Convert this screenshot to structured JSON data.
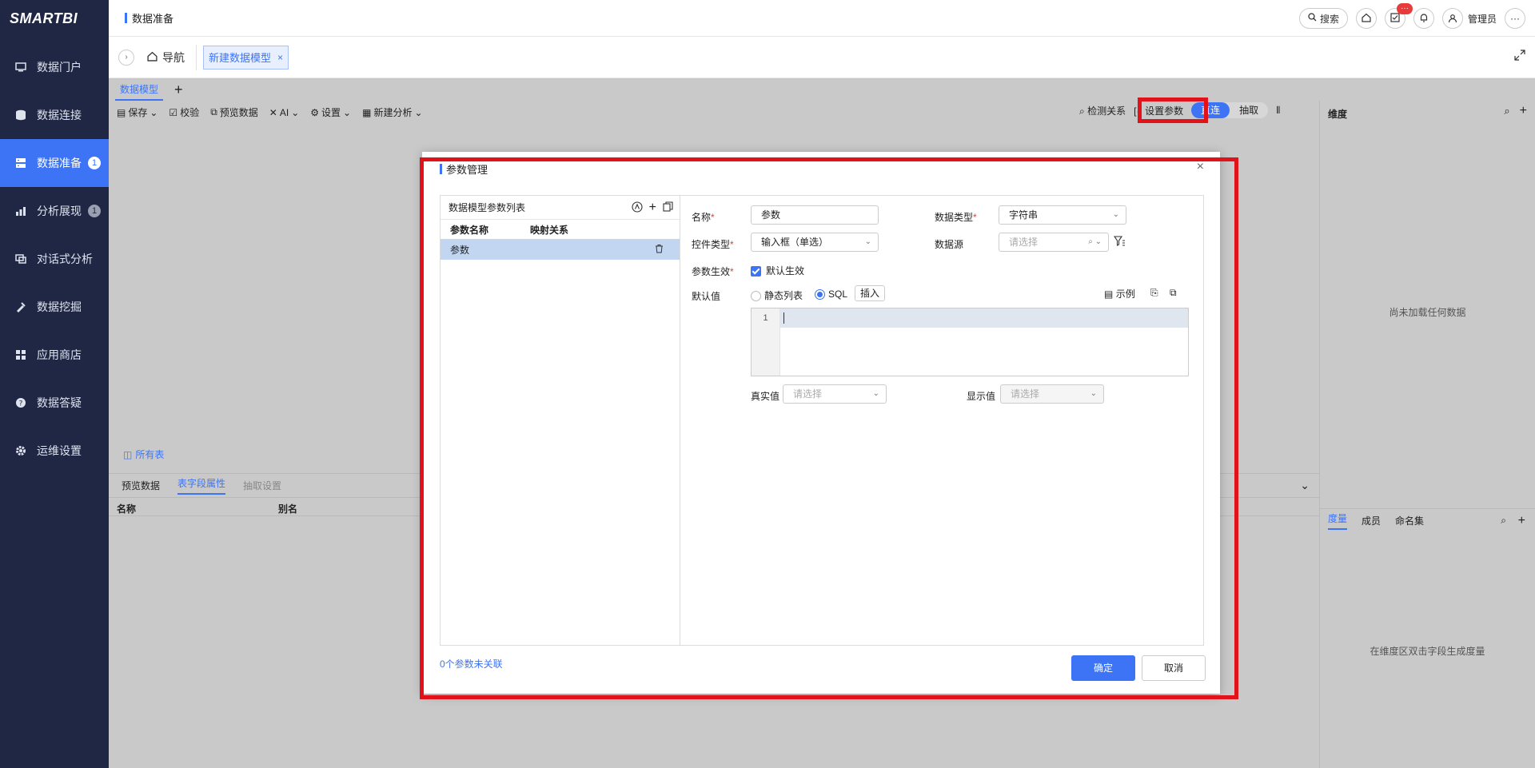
{
  "app": {
    "logo": "SMARTBI",
    "page_title": "数据准备"
  },
  "header": {
    "search_label": "搜索",
    "task_badge": "···",
    "user_name": "管理员"
  },
  "sidebar": {
    "items": [
      {
        "label": "数据门户",
        "icon": "monitor-icon"
      },
      {
        "label": "数据连接",
        "icon": "database-icon"
      },
      {
        "label": "数据准备",
        "icon": "server-icon",
        "badge": "1",
        "active": true
      },
      {
        "label": "分析展现",
        "icon": "bar-chart-icon",
        "badge": "1"
      },
      {
        "label": "对话式分析",
        "icon": "chat-icon"
      },
      {
        "label": "数据挖掘",
        "icon": "pick-icon"
      },
      {
        "label": "应用商店",
        "icon": "apps-icon"
      },
      {
        "label": "数据答疑",
        "icon": "question-icon"
      },
      {
        "label": "运维设置",
        "icon": "gear-icon"
      }
    ]
  },
  "tabs": {
    "home": "导航",
    "current": "新建数据模型"
  },
  "workspace": {
    "tab": "数据模型",
    "toolbar": {
      "save": "保存",
      "check": "校验",
      "preview": "预览数据",
      "ai": "AI",
      "settings": "设置",
      "new_analysis": "新建分析"
    },
    "right_tools": {
      "detect": "检测关系",
      "set_params": "设置参数",
      "direct": "直连",
      "extract": "抽取"
    },
    "all_tables": "所有表",
    "bottom_tabs": {
      "preview": "预览数据",
      "field_props": "表字段属性",
      "extract_settings": "抽取设置"
    },
    "bottom_cols": {
      "name": "名称",
      "alias": "别名"
    },
    "right_panel": {
      "dimension_title": "维度",
      "dimension_empty": "尚未加载任何数据",
      "tabs": {
        "measure": "度量",
        "member": "成员",
        "named_set": "命名集"
      },
      "measure_empty": "在维度区双击字段生成度量"
    }
  },
  "modal": {
    "title": "参数管理",
    "list": {
      "header": "数据模型参数列表",
      "col_name": "参数名称",
      "col_mapping": "映射关系",
      "rows": [
        {
          "name": "参数",
          "mapping": ""
        }
      ]
    },
    "form": {
      "name_label": "名称",
      "name_value": "参数",
      "data_type_label": "数据类型",
      "data_type_value": "字符串",
      "control_type_label": "控件类型",
      "control_type_value": "输入框（单选）",
      "data_source_label": "数据源",
      "data_source_placeholder": "请选择",
      "effect_label": "参数生效",
      "effect_checkbox": "默认生效",
      "default_label": "默认值",
      "radio_static": "静态列表",
      "radio_sql": "SQL",
      "insert": "插入",
      "example": "示例",
      "line_number": "1",
      "real_value_label": "真实值",
      "real_value_placeholder": "请选择",
      "display_value_label": "显示值",
      "display_value_placeholder": "请选择"
    },
    "unlinked": "0个参数未关联",
    "ok": "确定",
    "cancel": "取消"
  },
  "colors": {
    "accent": "#3d74f5",
    "sidebar": "#1f2745",
    "highlight": "#e2121a"
  }
}
